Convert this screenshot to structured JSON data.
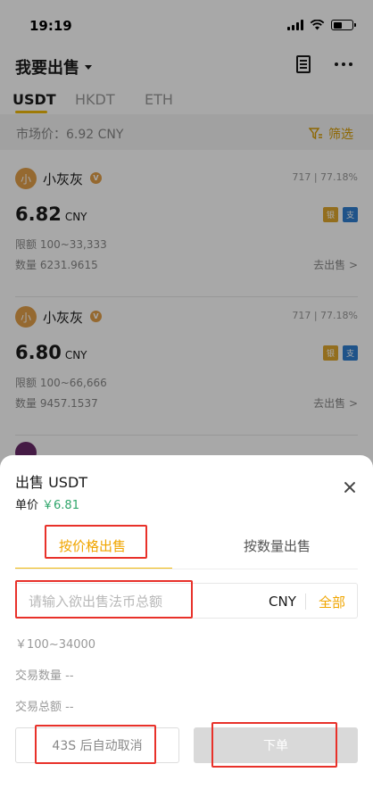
{
  "status_bar": {
    "time": "19:19"
  },
  "nav": {
    "title": "我要出售"
  },
  "coin_tabs": [
    "USDT",
    "HKDT",
    "ETH"
  ],
  "market": {
    "price_text": "市场价：6.92 CNY",
    "filter_label": "筛选"
  },
  "listings": [
    {
      "avatar_char": "小",
      "name": "小灰灰",
      "verified": "V",
      "stats": "717 | 77.18%",
      "price": "6.82",
      "price_unit": "CNY",
      "pay_bank": "银",
      "pay_alipay": "支",
      "limit": "限额 100~33,333",
      "quantity": "数量 6231.9615",
      "sell_link": "去出售 >"
    },
    {
      "avatar_char": "小",
      "name": "小灰灰",
      "verified": "V",
      "stats": "717 | 77.18%",
      "price": "6.80",
      "price_unit": "CNY",
      "pay_bank": "银",
      "pay_alipay": "支",
      "limit": "限额 100~66,666",
      "quantity": "数量 9457.1537",
      "sell_link": "去出售 >"
    }
  ],
  "sheet": {
    "title": "出售 USDT",
    "unit_price_label": "单价",
    "unit_price_value": "￥6.81",
    "tabs": [
      "按价格出售",
      "按数量出售"
    ],
    "amount_placeholder": "请输入欲出售法币总额",
    "currency": "CNY",
    "all_label": "全部",
    "range": "￥100~34000",
    "trade_qty": "交易数量 --",
    "trade_total": "交易总额 --",
    "cancel_btn": "43S 后自动取消",
    "order_btn": "下单"
  },
  "colors": {
    "accent": "#f0b90b",
    "accent_text": "#f0a500",
    "price_green": "#2ea56a",
    "annotation_red": "#e8312a",
    "disabled_button": "#d9d9d9"
  }
}
